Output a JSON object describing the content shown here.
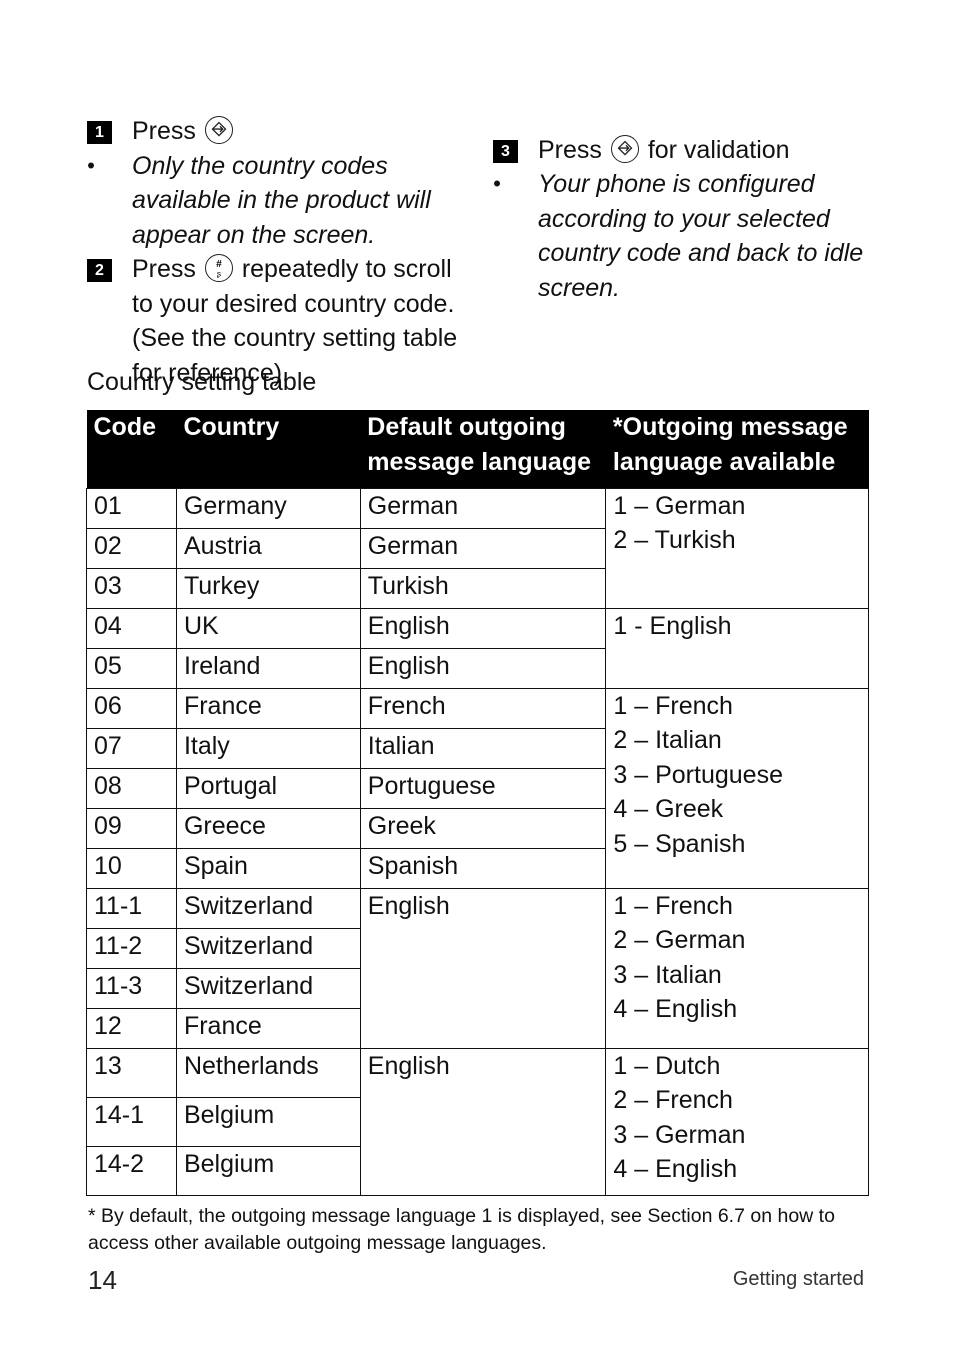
{
  "instructions": {
    "step1": {
      "number": "1",
      "text": "Press",
      "icon": "ok-arrow-icon"
    },
    "step1_note": "Only the country codes available in the product will appear on the screen.",
    "step2": {
      "number": "2",
      "text_before": "Press",
      "icon": "hash-key-icon",
      "text_after": "repeatedly to scroll to your desired country code. (See the country setting table for reference)."
    },
    "step3": {
      "number": "3",
      "text_before": "Press",
      "icon": "ok-arrow-icon",
      "text_after": "for validation"
    },
    "step3_note": "Your phone is configured according to your selected country code and back to idle screen."
  },
  "table": {
    "caption": "Country setting table",
    "headers": [
      "Code",
      "Country",
      "Default outgoing message language",
      "*Outgoing message language available"
    ],
    "groups": [
      {
        "rows": [
          {
            "code": "01",
            "country": "Germany",
            "default": "German"
          },
          {
            "code": "02",
            "country": "Austria",
            "default": "German"
          },
          {
            "code": "03",
            "country": "Turkey",
            "default": "Turkish"
          }
        ],
        "available": [
          "1 – German",
          "2 – Turkish"
        ]
      },
      {
        "rows": [
          {
            "code": "04",
            "country": "UK",
            "default": "English"
          },
          {
            "code": "05",
            "country": "Ireland",
            "default": "English"
          }
        ],
        "available": [
          "1 - English"
        ]
      },
      {
        "rows": [
          {
            "code": "06",
            "country": "France",
            "default": "French"
          },
          {
            "code": "07",
            "country": "Italy",
            "default": "Italian"
          },
          {
            "code": "08",
            "country": "Portugal",
            "default": "Portuguese"
          },
          {
            "code": "09",
            "country": "Greece",
            "default": "Greek"
          },
          {
            "code": "10",
            "country": "Spain",
            "default": "Spanish"
          }
        ],
        "available": [
          "1 – French",
          "2 – Italian",
          "3 – Portuguese",
          "4 – Greek",
          "5 – Spanish"
        ]
      },
      {
        "rows": [
          {
            "code": "11-1",
            "country": "Switzerland"
          },
          {
            "code": "11-2",
            "country": "Switzerland"
          },
          {
            "code": "11-3",
            "country": "Switzerland"
          },
          {
            "code": "12",
            "country": "France"
          }
        ],
        "default_merged": "English",
        "available": [
          "1 – French",
          "2 – German",
          "3 – Italian",
          "4 – English"
        ]
      },
      {
        "rows": [
          {
            "code": "13",
            "country": "Netherlands"
          },
          {
            "code": "14-1",
            "country": "Belgium"
          },
          {
            "code": "14-2",
            "country": "Belgium"
          }
        ],
        "default_merged": "English",
        "available": [
          "1 – Dutch",
          "2 – French",
          "3 – German",
          "4 – English"
        ]
      }
    ]
  },
  "footnote": "* By default, the outgoing message language 1 is displayed, see Section 6.7 on how to access other available outgoing message languages.",
  "footer": {
    "page_number": "14",
    "section": "Getting started"
  }
}
